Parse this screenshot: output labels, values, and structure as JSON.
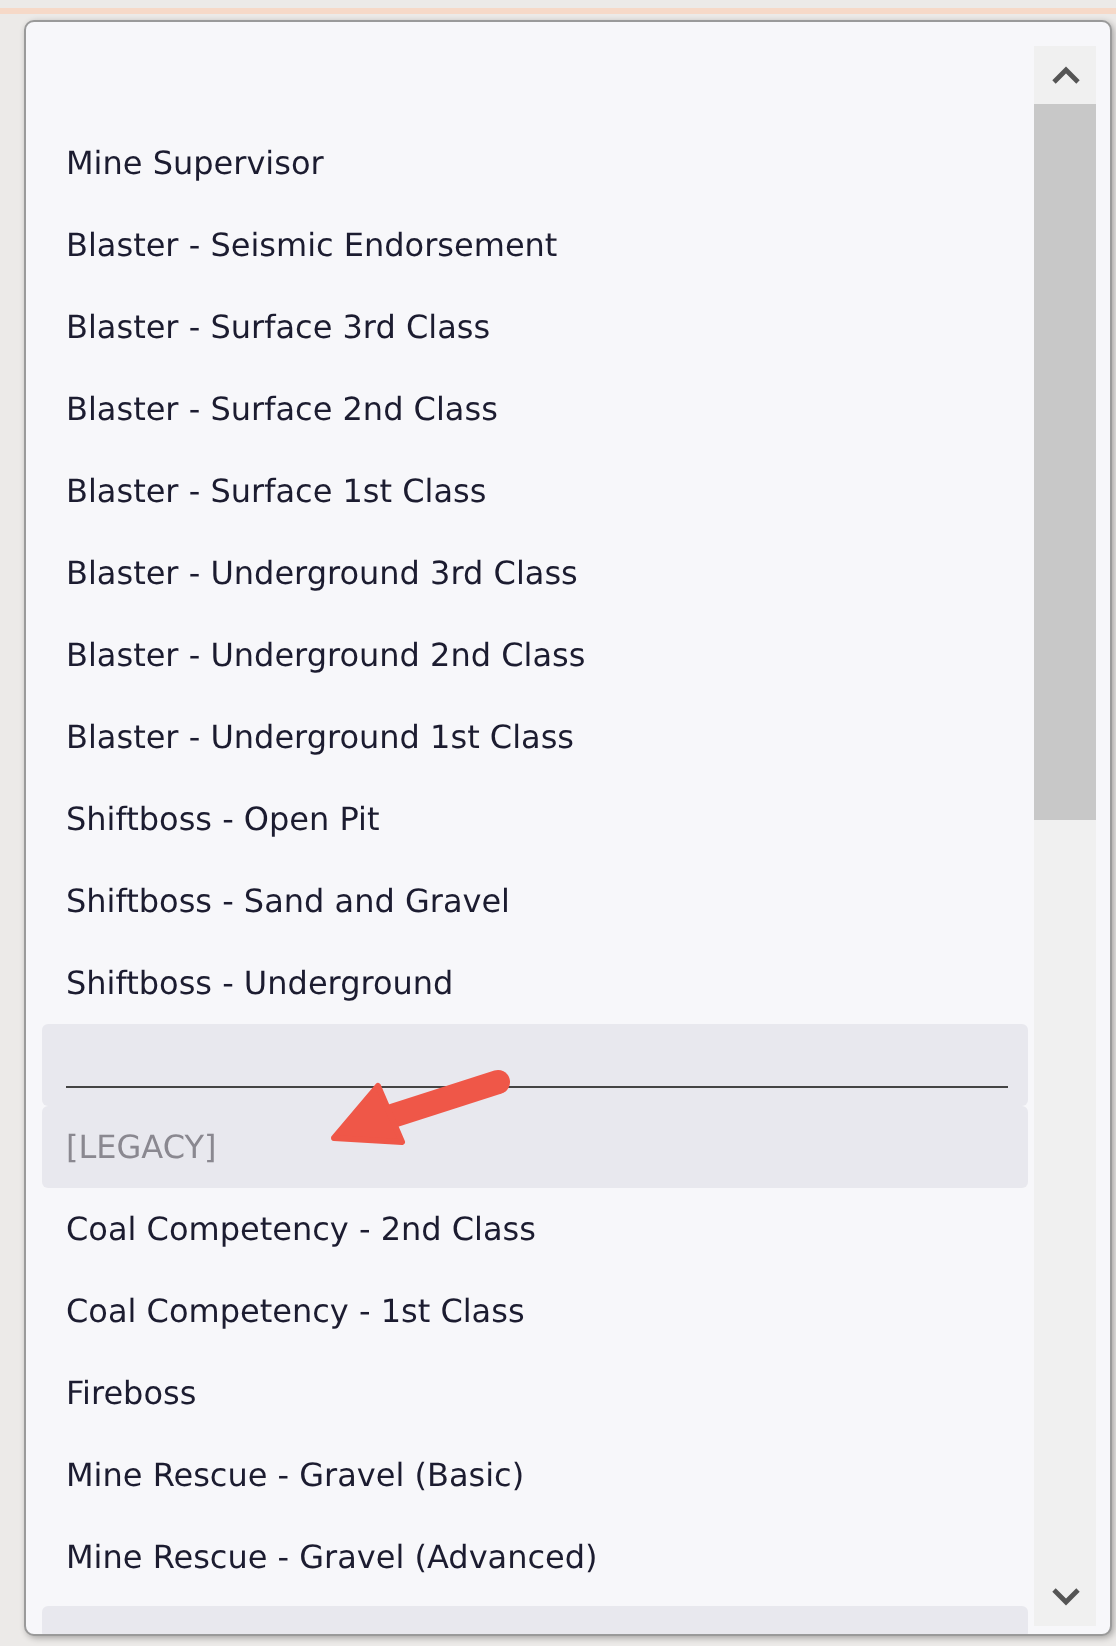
{
  "items": [
    {
      "kind": "item",
      "label": "Mine Supervisor",
      "highlighted": false,
      "disabled": false
    },
    {
      "kind": "item",
      "label": "Blaster - Seismic Endorsement",
      "highlighted": false,
      "disabled": false
    },
    {
      "kind": "item",
      "label": "Blaster - Surface 3rd Class",
      "highlighted": false,
      "disabled": false
    },
    {
      "kind": "item",
      "label": "Blaster - Surface 2nd Class",
      "highlighted": false,
      "disabled": false
    },
    {
      "kind": "item",
      "label": "Blaster - Surface 1st Class",
      "highlighted": false,
      "disabled": false
    },
    {
      "kind": "item",
      "label": "Blaster - Underground 3rd Class",
      "highlighted": false,
      "disabled": false
    },
    {
      "kind": "item",
      "label": "Blaster - Underground 2nd Class",
      "highlighted": false,
      "disabled": false
    },
    {
      "kind": "item",
      "label": "Blaster - Underground 1st Class",
      "highlighted": false,
      "disabled": false
    },
    {
      "kind": "item",
      "label": "Shiftboss - Open Pit",
      "highlighted": false,
      "disabled": false
    },
    {
      "kind": "item",
      "label": "Shiftboss - Sand and Gravel",
      "highlighted": false,
      "disabled": false
    },
    {
      "kind": "item",
      "label": "Shiftboss - Underground",
      "highlighted": false,
      "disabled": false
    },
    {
      "kind": "separator",
      "highlighted": true
    },
    {
      "kind": "item",
      "label": "[LEGACY]",
      "highlighted": true,
      "disabled": true
    },
    {
      "kind": "item",
      "label": "Coal Competency - 2nd Class",
      "highlighted": false,
      "disabled": false
    },
    {
      "kind": "item",
      "label": "Coal Competency - 1st Class",
      "highlighted": false,
      "disabled": false
    },
    {
      "kind": "item",
      "label": "Fireboss",
      "highlighted": false,
      "disabled": false
    },
    {
      "kind": "item",
      "label": "Mine Rescue - Gravel (Basic)",
      "highlighted": false,
      "disabled": false
    },
    {
      "kind": "item",
      "label": "Mine Rescue - Gravel (Advanced)",
      "highlighted": false,
      "disabled": false
    },
    {
      "kind": "partial",
      "highlighted": true
    }
  ]
}
